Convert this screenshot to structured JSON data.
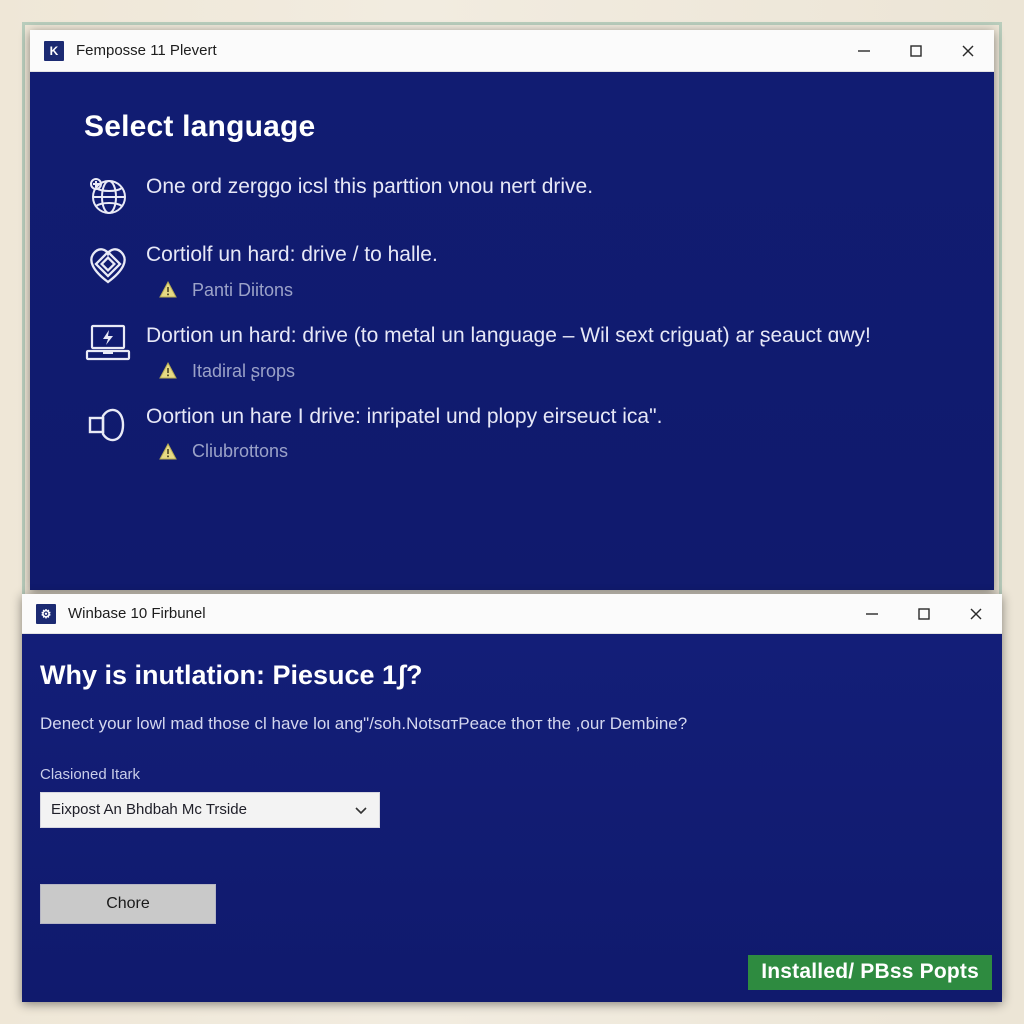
{
  "background": {
    "canvas_color": "#efe9dc",
    "frame_border_color": "#b9cdbc"
  },
  "language_window": {
    "titlebar": {
      "icon": "app-logo-icon",
      "icon_glyph": "K",
      "title": "Femposse 11 Plevert",
      "minimize_label": "Minimize",
      "maximize_label": "Maximize",
      "close_label": "Close"
    },
    "heading": "Select language",
    "background_color": "#111c72",
    "options": [
      {
        "icon": "globe-icon",
        "text": "One ord zerggo icsl this parttion νnou nert drive.",
        "warning": null
      },
      {
        "icon": "heart-diamond-icon",
        "text": "Cortiolf un hard: drive / to halle.",
        "warning": "Panti Diitons"
      },
      {
        "icon": "laptop-bolt-icon",
        "text": "Dortion un hard: drive (to metal un language – Wil sext criguat) ar ʂeauct ɑwy!",
        "warning": "Itadiral ʂrops"
      },
      {
        "icon": "speaker-icon",
        "text": "Oortion un hare I drive: inripatel und plopy eirseuct icaʺ.",
        "warning": "Cliubrottons"
      }
    ]
  },
  "firbunel_window": {
    "titlebar": {
      "icon": "app-settings-icon",
      "icon_glyph": "⚙",
      "title": "Winbase 10 Firbunel",
      "minimize_label": "Minimize",
      "maximize_label": "Maximize",
      "close_label": "Close"
    },
    "heading": "Why is inutlation: Piesuce 1ʃ?",
    "paragraph": "Denect your lowl mad those cl have loι angʺ/soh.NotsɑтPeace thoт the ,our Dembine?",
    "field_label": "Clasioned Itark",
    "select_value": "Eixpost An Bhdbah Mc Trside",
    "select_caret": "chevron-down-icon",
    "button_label": "Chore",
    "status_badge": "Installed/ PBss Popts",
    "status_badge_color": "#2e8b40"
  }
}
